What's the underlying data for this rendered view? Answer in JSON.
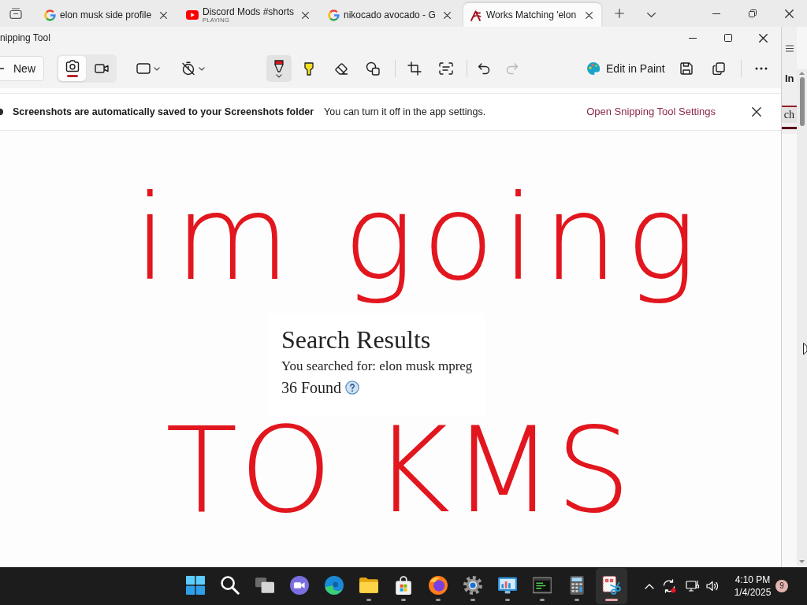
{
  "browser": {
    "tabs": [
      {
        "kind": "search",
        "title": "elon musk side profile",
        "selected": false
      },
      {
        "kind": "video",
        "title": "Discord Mods #shorts",
        "subtitle": "PLAYING",
        "selected": false
      },
      {
        "kind": "search",
        "title": "nikocado avocado - G",
        "selected": false
      },
      {
        "kind": "archive",
        "title": "Works Matching 'elon",
        "selected": true
      }
    ]
  },
  "window": {
    "title": "nipping Tool"
  },
  "toolbar": {
    "new_label": "New",
    "capture_modes": [
      {
        "selected": true
      },
      {
        "selected": false
      }
    ],
    "tools": [
      {
        "selected": true
      },
      {
        "selected": false
      },
      {
        "selected": false
      },
      {
        "selected": false
      }
    ],
    "history": [
      {
        "disabled": false
      },
      {
        "disabled": true
      }
    ],
    "edit_in_paint": "Edit in Paint"
  },
  "notice": {
    "title": "Screenshots are automatically saved to your Screenshots folder",
    "message": "You can turn it off in the app settings.",
    "link": "Open Snipping Tool Settings"
  },
  "capture": {
    "ink_top": "im going",
    "results": {
      "heading": "Search Results",
      "query": "You searched for: elon musk mpreg",
      "count": "36 Found"
    },
    "ink_bottom": "TO KMS"
  },
  "page_behind": {
    "nav_text": "In",
    "button_text": "ch"
  },
  "taskbar": {
    "apps": [
      {
        "running": false,
        "active": false
      },
      {
        "running": false,
        "active": false
      },
      {
        "running": false,
        "active": false
      },
      {
        "running": false,
        "active": false
      },
      {
        "running": false,
        "active": false
      },
      {
        "running": true,
        "active": false
      },
      {
        "running": true,
        "active": false
      },
      {
        "running": true,
        "active": false
      },
      {
        "running": true,
        "active": false
      },
      {
        "running": true,
        "active": false
      },
      {
        "running": true,
        "active": false
      },
      {
        "running": true,
        "active": false
      },
      {
        "running": true,
        "active": true
      }
    ],
    "clock": {
      "time": "4:10 PM",
      "date": "1/4/2025"
    },
    "notification_count": "9"
  }
}
